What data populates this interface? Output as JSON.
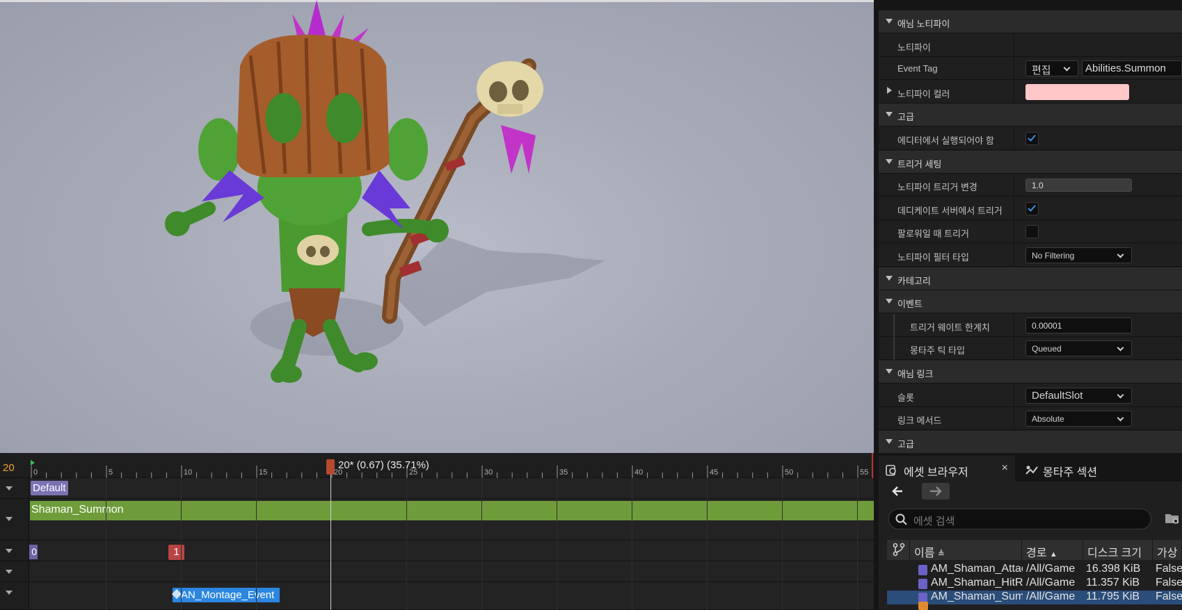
{
  "details": {
    "rows": [
      {
        "kind": "cat",
        "label": "애님 노티파이",
        "open": true
      },
      {
        "kind": "prop",
        "label": "노티파이"
      },
      {
        "kind": "prop",
        "label": "Event Tag",
        "edit_label": "편집",
        "tag_value": "Abilities.Summon"
      },
      {
        "kind": "prop-collapsed",
        "label": "노티파이 컬러",
        "color": "#ffc7c7"
      },
      {
        "kind": "cat",
        "label": "고급",
        "open": true
      },
      {
        "kind": "prop",
        "label": "에디터에서 실행되어야 함",
        "checked": true
      },
      {
        "kind": "cat",
        "label": "트리거 세팅",
        "open": true
      },
      {
        "kind": "prop",
        "label": "노티파이 트리거 변경",
        "value": "1.0"
      },
      {
        "kind": "prop",
        "label": "데디케이트 서버에서 트리거",
        "checked": true
      },
      {
        "kind": "prop",
        "label": "팔로워일 때 트리거",
        "checked": false
      },
      {
        "kind": "prop",
        "label": "노티파이 필터 타입",
        "value": "No Filtering"
      },
      {
        "kind": "cat",
        "label": "카테고리",
        "open": true
      },
      {
        "kind": "cat",
        "label": "이벤트",
        "open": true
      },
      {
        "kind": "prop",
        "label": "트리거 웨이트 한계치",
        "value": "0.00001"
      },
      {
        "kind": "prop",
        "label": "몽타주 틱 타입",
        "value": "Queued"
      },
      {
        "kind": "cat",
        "label": "애님 링크",
        "open": true
      },
      {
        "kind": "prop",
        "label": "슬롯",
        "value": "DefaultSlot"
      },
      {
        "kind": "prop",
        "label": "링크 메서드",
        "value": "Absolute"
      },
      {
        "kind": "cat",
        "label": "고급",
        "open": true
      }
    ]
  },
  "timeline": {
    "current_frame": "20",
    "playhead_label": "20* (0.67) (35.71%)",
    "ruler_ticks": [
      "0",
      "5",
      "10",
      "15",
      "20",
      "25",
      "30",
      "35",
      "40",
      "45",
      "50",
      "55"
    ],
    "slot_group": "Default",
    "section_name": "Shaman_Summon",
    "section_markers": [
      "0",
      "1"
    ],
    "notify_name": "AN_Montage_Event"
  },
  "asset_browser": {
    "tabs": [
      "에셋 브라우저",
      "몽타주 섹션"
    ],
    "search_placeholder": "에셋 검색",
    "columns": [
      "이름",
      "경로",
      "디스크 크기",
      "가상"
    ],
    "rows": [
      {
        "name": "AM_Shaman_Attack",
        "path": "/All/Game",
        "size": "16.398 KiB",
        "virtual": "False",
        "selected": false
      },
      {
        "name": "AM_Shaman_HitReact",
        "path": "/All/Game",
        "size": "11.357 KiB",
        "virtual": "False",
        "selected": false
      },
      {
        "name": "AM_Shaman_Summon",
        "path": "/All/Game",
        "size": "11.795 KiB",
        "virtual": "False",
        "selected": true
      }
    ]
  }
}
